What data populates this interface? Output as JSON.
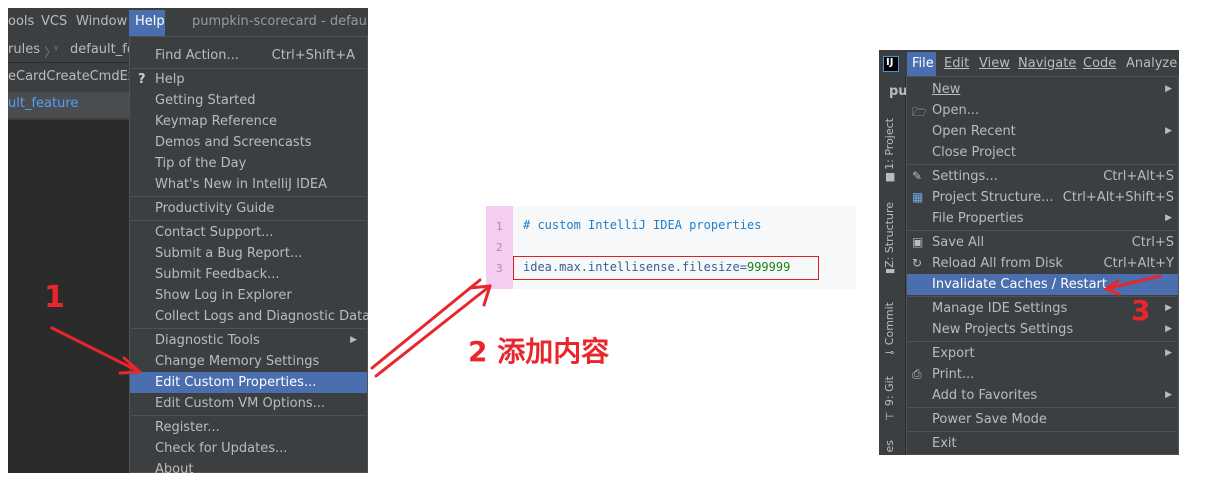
{
  "colors": {
    "accent": "#4b6eaf",
    "annotation_red": "#e8262b",
    "ide_background": "#3c3f41",
    "gutter_pink": "#f5cdf0",
    "comment_blue": "#1e7fc8",
    "value_green": "#188018"
  },
  "left_ide": {
    "menubar": {
      "tools": "ools",
      "vcs": "VCS",
      "window": "Window",
      "help": "Help"
    },
    "window_title": "pumpkin-scorecard - default_f",
    "breadcrumb": {
      "first": "rules",
      "second": "default_fea"
    },
    "editor_tab": "eCardCreateCmdExe",
    "selected_tab": "ult_feature",
    "help_menu": {
      "find_action": "Find Action...",
      "find_action_shortcut": "Ctrl+Shift+A",
      "help_icon": "?",
      "help": "Help",
      "getting_started": "Getting Started",
      "keymap_reference": "Keymap Reference",
      "demos": "Demos and Screencasts",
      "tip_of_day": "Tip of the Day",
      "whats_new": "What's New in IntelliJ IDEA",
      "productivity_guide": "Productivity Guide",
      "contact_support": "Contact Support...",
      "submit_bug": "Submit a Bug Report...",
      "submit_feedback": "Submit Feedback...",
      "show_log": "Show Log in Explorer",
      "collect_logs": "Collect Logs and Diagnostic Data",
      "diagnostic_tools": "Diagnostic Tools",
      "change_memory": "Change Memory Settings",
      "edit_custom_properties": "Edit Custom Properties...",
      "edit_custom_vm": "Edit Custom VM Options...",
      "register": "Register...",
      "check_updates": "Check for Updates...",
      "about": "About"
    }
  },
  "code_snippet": {
    "line_numbers": [
      "1",
      "2",
      "3"
    ],
    "comment": "# custom IntelliJ IDEA properties",
    "property_key": "idea.max.intellisense.filesize",
    "equals": "=",
    "property_value": "999999"
  },
  "annotations": {
    "step1": "1",
    "step2": "2 添加内容",
    "step3": "3"
  },
  "right_ide": {
    "logo_letter": "IJ",
    "menubar": {
      "file": "File",
      "edit": "Edit",
      "view": "View",
      "navigate": "Navigate",
      "code": "Code",
      "analyze": "Analyze"
    },
    "project_label": "pu",
    "side_tabs": {
      "project": "1: Project",
      "structure": "Z: Structure",
      "commit": "Commit",
      "git": "9: Git",
      "extra": "es"
    },
    "file_menu": {
      "new": "New",
      "open": "Open...",
      "open_recent": "Open Recent",
      "close_project": "Close Project",
      "settings": "Settings...",
      "settings_shortcut": "Ctrl+Alt+S",
      "project_structure": "Project Structure...",
      "project_structure_shortcut": "Ctrl+Alt+Shift+S",
      "file_properties": "File Properties",
      "save_all": "Save All",
      "save_all_shortcut": "Ctrl+S",
      "reload_all": "Reload All from Disk",
      "reload_all_shortcut": "Ctrl+Alt+Y",
      "invalidate_caches": "Invalidate Caches / Restart...",
      "manage_ide_settings": "Manage IDE Settings",
      "new_projects_settings": "New Projects Settings",
      "export": "Export",
      "print": "Print...",
      "add_to_favorites": "Add to Favorites",
      "power_save_mode": "Power Save Mode",
      "exit": "Exit"
    }
  }
}
